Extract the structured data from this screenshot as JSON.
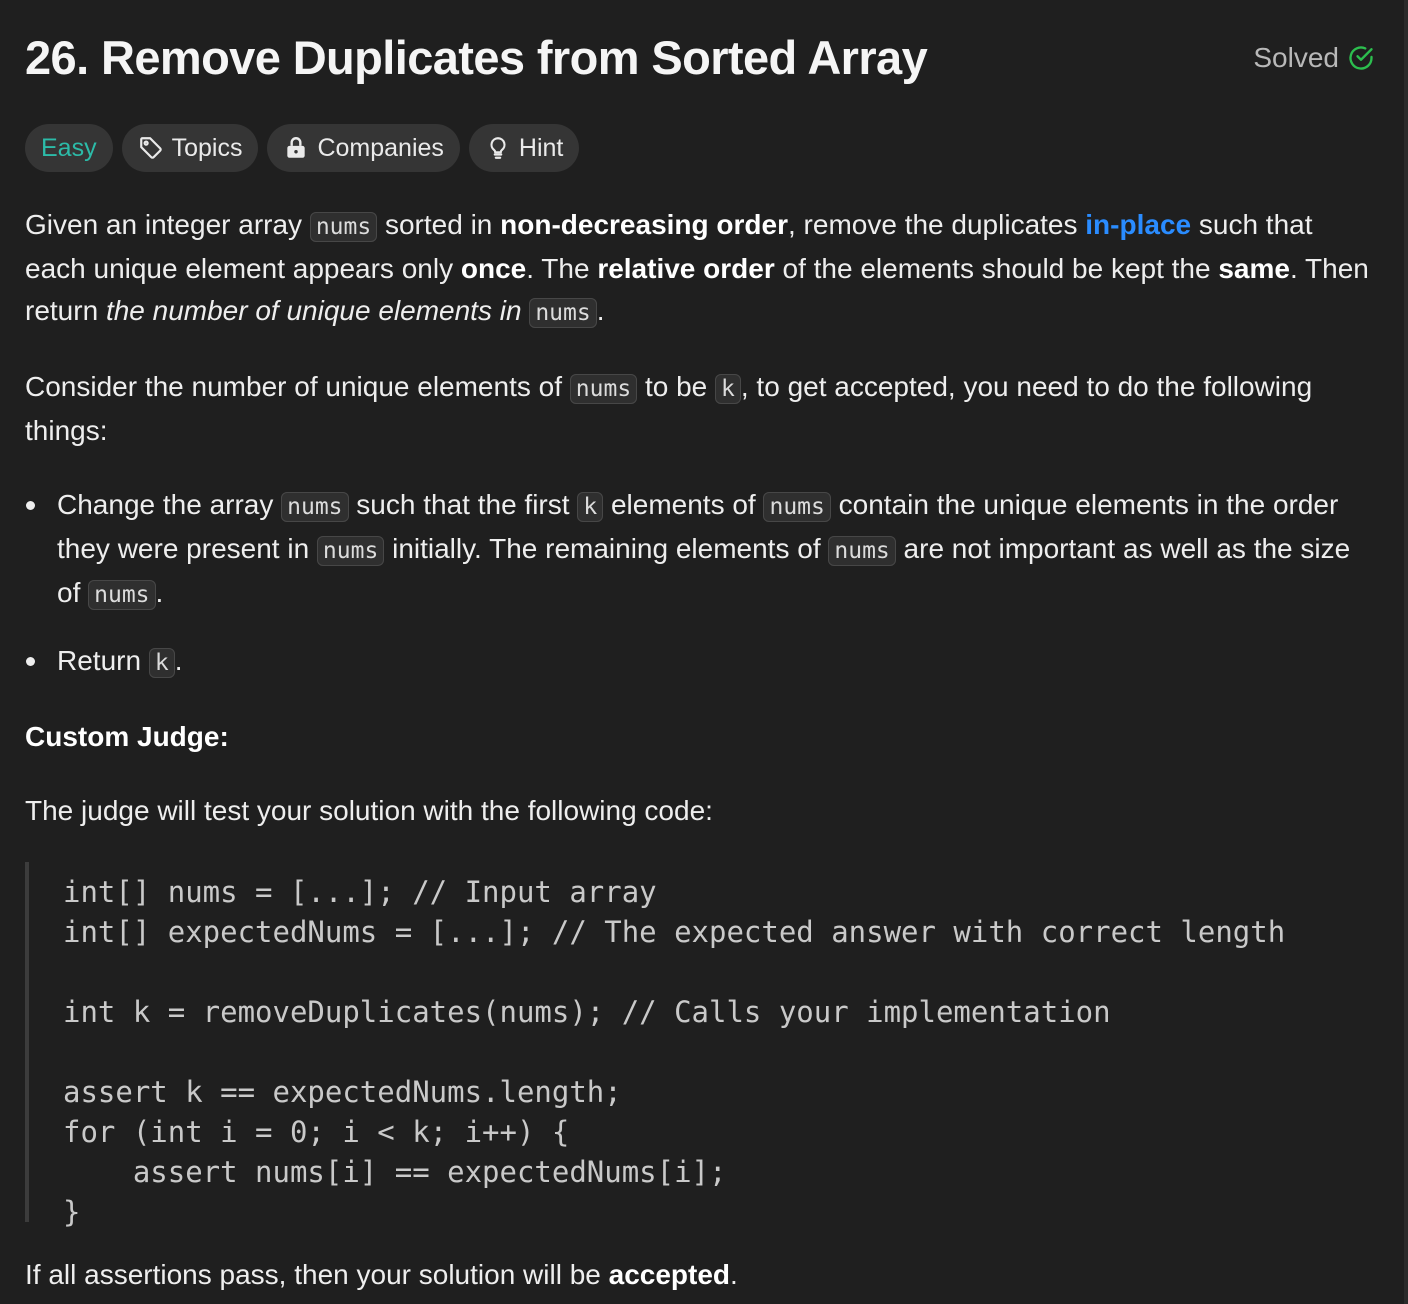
{
  "problem": {
    "title": "26. Remove Duplicates from Sorted Array",
    "status": "Solved"
  },
  "tags": {
    "difficulty": "Easy",
    "topics": "Topics",
    "companies": "Companies",
    "hint": "Hint"
  },
  "colors": {
    "background": "#1f1f1f",
    "easy": "#2cbba8",
    "solved_check": "#2cbe4e",
    "link_blue": "#2a8cff"
  },
  "icons": {
    "solved": "check-circle-icon",
    "topics": "tag-icon",
    "companies": "lock-icon",
    "hint": "lightbulb-icon"
  },
  "description": {
    "p1": {
      "t1": "Given an integer array ",
      "c1": "nums",
      "t2": " sorted in ",
      "b1": "non-decreasing order",
      "t3": ", remove the duplicates ",
      "link": "in-place",
      "t4": " such that each unique element appears only ",
      "b2": "once",
      "t5": ". The ",
      "b3": "relative order",
      "t6": " of the elements should be kept the ",
      "b4": "same",
      "t7": ". Then return ",
      "i1": "the number of unique elements in ",
      "c2": "nums",
      "t8": "."
    },
    "p2": {
      "t1": "Consider the number of unique elements of ",
      "c1": "nums",
      "t2": " to be ",
      "c2": "k",
      "t3": ", to get accepted, you need to do the following things:"
    },
    "bullet1": {
      "t1": "Change the array ",
      "c1": "nums",
      "t2": " such that the first ",
      "c2": "k",
      "t3": " elements of ",
      "c3": "nums",
      "t4": " contain the unique elements in the order they were present in ",
      "c4": "nums",
      "t5": " initially. The remaining elements of ",
      "c5": "nums",
      "t6": " are not important as well as the size of ",
      "c6": "nums",
      "t7": "."
    },
    "bullet2": {
      "t1": "Return ",
      "c1": "k",
      "t2": "."
    },
    "custom_judge_heading": "Custom Judge:",
    "judge_intro": "The judge will test your solution with the following code:",
    "code": "int[] nums = [...]; // Input array\nint[] expectedNums = [...]; // The expected answer with correct length\n\nint k = removeDuplicates(nums); // Calls your implementation\n\nassert k == expectedNums.length;\nfor (int i = 0; i < k; i++) {\n    assert nums[i] == expectedNums[i];\n}",
    "final": {
      "t1": "If all assertions pass, then your solution will be ",
      "b1": "accepted",
      "t2": "."
    }
  }
}
